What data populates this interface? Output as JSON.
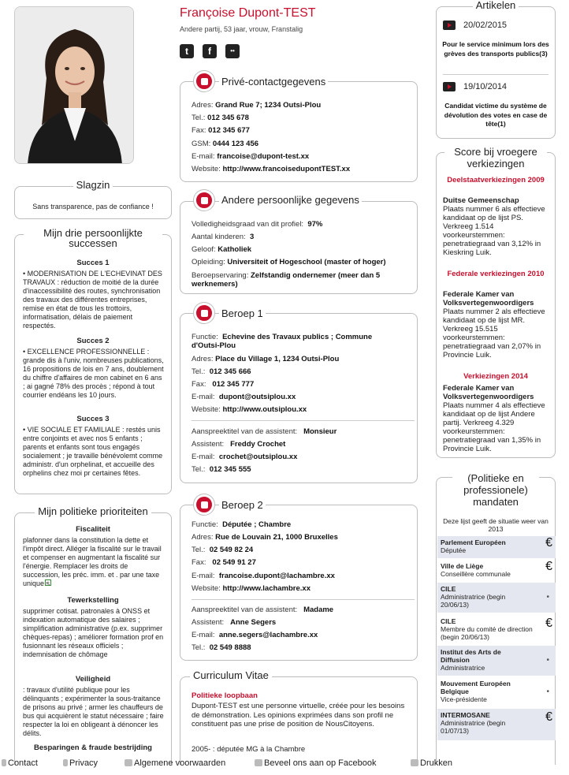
{
  "profile": {
    "name": "Françoise Dupont-TEST",
    "subtitle": "Andere partij, 53 jaar, vrouw, Franstalig"
  },
  "social": [
    {
      "name": "twitter-icon",
      "glyph": "t"
    },
    {
      "name": "facebook-icon",
      "glyph": "f"
    },
    {
      "name": "flickr-icon",
      "glyph": "••"
    }
  ],
  "slagzin": {
    "title": "Slagzin",
    "text": "Sans transparence, pas de confiance !"
  },
  "successes": {
    "title": "Mijn drie persoonlijkte successen",
    "items": [
      {
        "head": "Succes 1",
        "text": "• MODERNISATION DE L'ECHEVINAT DES TRAVAUX : réduction de moitié de la durée d'inaccessibilité des routes, synchronisation des travaux des différentes entreprises, remise en état de tous les trottoirs, informatisation, délais de paiement respectés."
      },
      {
        "head": "Succes 2",
        "text": "• EXCELLENCE PROFESSIONNELLE : grande dis à l'univ, nombreuses publications, 16 propositions de lois en 7 ans, doublement du chiffre d'affaires de mon cabinet en 6 ans ; ai gagné 78% des procès ; répond à tout courrier endéans les 10 jours."
      },
      {
        "head": "Succes 3",
        "text": "• VIE SOCIALE ET FAMILIALE : restés unis entre conjoints et avec nos 5 enfants ; parents et enfants sont tous engagés socialement ; je travaille bénévolemt comme administr. d'un orphelinat, et accueille des orphelins chez moi pr certaines fêtes."
      }
    ]
  },
  "priorities": {
    "title": "Mijn politieke prioriteiten",
    "items": [
      {
        "head": "Fiscaliteit",
        "text": "plafonner dans la constitution la dette et l'impôt direct. Alléger la fiscalité sur le travail et compenser en augmentant la fiscalité sur l'énergie. Remplacer les droits de succession, les préc. imm. et     . par une taxe unique s"
      },
      {
        "head": "Tewerkstelling",
        "text": "supprimer cotisat. patronales à ONSS et indexation automatique des salaires ; simplification administrative (p.ex. supprimer chèques-repas) ; améliorer formation prof en fusionnant les réseaux officiels ; indemnisation de chômage"
      },
      {
        "head": "Veiligheid",
        "text": ": travaux d'utilité publique pour les délinquants ; expérimenter la sous-traitance de prisons au privé ; armer les chauffeurs de bus qui acquièrent le statut nécessaire ; faire respecter la loi en obligeant à dénoncer les délits."
      },
      {
        "head": "Besparingen & fraude bestrijding",
        "text": ""
      }
    ]
  },
  "contact": {
    "title": "Privé-contactgegevens",
    "rows": [
      {
        "label": "Adres:",
        "value": "Grand Rue 7; 1234 Outsi-Plou"
      },
      {
        "label": "Tel.:",
        "value": "012 345 678"
      },
      {
        "label": "Fax:",
        "value": "012 345 677"
      },
      {
        "label": "GSM:",
        "value": "0444 123 456"
      },
      {
        "label": "E-mail:",
        "value": "francoise@dupont-test.xx"
      },
      {
        "label": "Website:",
        "value": "http://www.francoisedupontTEST.xx"
      }
    ]
  },
  "personal": {
    "title": "Andere persoonlijke gegevens",
    "rows": [
      {
        "label": "Volledigheidsgraad van dit profiel:",
        "value": "97%"
      },
      {
        "label": "Aantal kinderen:",
        "value": "3"
      },
      {
        "label": "Geloof:",
        "value": "Katholiek"
      },
      {
        "label": "Opleiding:",
        "value": "Universiteit of Hogeschool (master of hoger)"
      },
      {
        "label": "Beroepservaring:",
        "value": "Zelfstandig ondernemer (meer dan 5"
      },
      {
        "label": "",
        "value": "werknemers)"
      }
    ]
  },
  "job1": {
    "title": "Beroep 1",
    "rows": [
      {
        "label": "Functie:",
        "value": "Echevine des Travaux publics ; Commune"
      },
      {
        "label": "",
        "value": "d'Outsi-Plou"
      },
      {
        "label": "Adres:",
        "value": "Place du Village 1, 1234 Outsi-Plou"
      },
      {
        "label": "Tel.:",
        "value": "012 345 666"
      },
      {
        "label": "Fax:",
        "value": "012 345 777"
      },
      {
        "label": "E-mail:",
        "value": "dupont@outsiplou.xx"
      },
      {
        "label": "Website:",
        "value": "http://www.outsiplou.xx"
      }
    ],
    "assistant": [
      {
        "label": "Aanspreektitel van de assistent:",
        "value": "Monsieur"
      },
      {
        "label": "Assistent:",
        "value": "Freddy Crochet"
      },
      {
        "label": "E-mail:",
        "value": "crochet@outsiplou.xx"
      },
      {
        "label": "Tel.:",
        "value": "012 345 555"
      }
    ]
  },
  "job2": {
    "title": "Beroep 2",
    "rows": [
      {
        "label": "Functie:",
        "value": "Députée ; Chambre"
      },
      {
        "label": "Adres:",
        "value": "Rue de Louvain 21, 1000 Bruxelles"
      },
      {
        "label": "Tel.:",
        "value": "02 549 82 24"
      },
      {
        "label": "Fax:",
        "value": "02 549 91 27"
      },
      {
        "label": "E-mail:",
        "value": "francoise.dupont@lachambre.xx"
      },
      {
        "label": "Website:",
        "value": "http://www.lachambre.xx"
      }
    ],
    "assistant": [
      {
        "label": "Aanspreektitel van de assistent:",
        "value": "Madame"
      },
      {
        "label": "Assistent:",
        "value": "Anne Segers"
      },
      {
        "label": "E-mail:",
        "value": "anne.segers@lachambre.xx"
      },
      {
        "label": "Tel.:",
        "value": "02 549 8888"
      }
    ]
  },
  "cv": {
    "title": "Curriculum Vitae",
    "section": "Politieke loopbaan",
    "text": "Dupont-TEST est une personne virtuelle, créée pour les besoins de démonstration. Les opinions exprimées dans son profil ne constituent pas une prise de position de NousCitoyens.",
    "line": "2005- : députée MG à la Chambre"
  },
  "articles": {
    "title": "Artikelen",
    "items": [
      {
        "date": "20/02/2015",
        "text": "Pour le service minimum lors des grèves des transports publics(3)"
      },
      {
        "date": "19/10/2014",
        "text": "Candidat victime du système de dévolution des votes en case de tête(1)"
      }
    ]
  },
  "scores": {
    "title": "Score bij vroegere verkiezingen",
    "items": [
      {
        "head": "Deelstaatverkiezingen 2009",
        "org": "Duitse Gemeenschap",
        "text": "Plaats nummer 6 als effectieve kandidaat op de lijst PS. Verkreeg 1.514 voorkeurstemmen: penetratiegraad van 3,12% in Kieskring Luik."
      },
      {
        "head": "Federale verkiezingen 2010",
        "org": "Federale Kamer van Volksvertegenwoordigers",
        "text": "Plaats nummer 2 als effectieve kandidaat op de lijst MR. Verkreeg 15.515 voorkeurstemmen: penetratiegraad van 2,07% in Provincie Luik."
      },
      {
        "head": "Verkiezingen 2014",
        "org": "Federale Kamer van Volksvertegenwoordigers",
        "text": "Plaats nummer 4 als effectieve kandidaat op de lijst Andere partij. Verkreeg 4.329 voorkeurstemmen: penetratiegraad van 1,35% in Provincie Luik."
      }
    ]
  },
  "mandates": {
    "title": "(Politieke en professionele) mandaten",
    "note": "Deze lijst geeft de situatie weer van 2013",
    "items": [
      {
        "org": "Parlement Européen",
        "role": "Députée",
        "paid": true
      },
      {
        "org": "Ville de Liège",
        "role": "Conseillère communale",
        "paid": true
      },
      {
        "org": "CILE",
        "role": "Administratrice (begin 20/06/13)",
        "paid": false
      },
      {
        "org": "CILE",
        "role": "Membre du comité de direction (begin 20/06/13)",
        "paid": true
      },
      {
        "org": "Institut des Arts de Diffusion",
        "role": "Administratrice",
        "paid": false
      },
      {
        "org": "Mouvement Européen Belgique",
        "role": "Vice-présidente",
        "paid": false
      },
      {
        "org": "INTERMOSANE",
        "role": "Administratrice (begin 01/07/13)",
        "paid": true
      }
    ],
    "euro": "€",
    "dot": "•"
  },
  "footer": {
    "contact": "Contact",
    "privacy": "Privacy",
    "terms": "Algemene voorwaarden",
    "facebook": "Beveel ons aan op Facebook",
    "print": "Drukken"
  }
}
